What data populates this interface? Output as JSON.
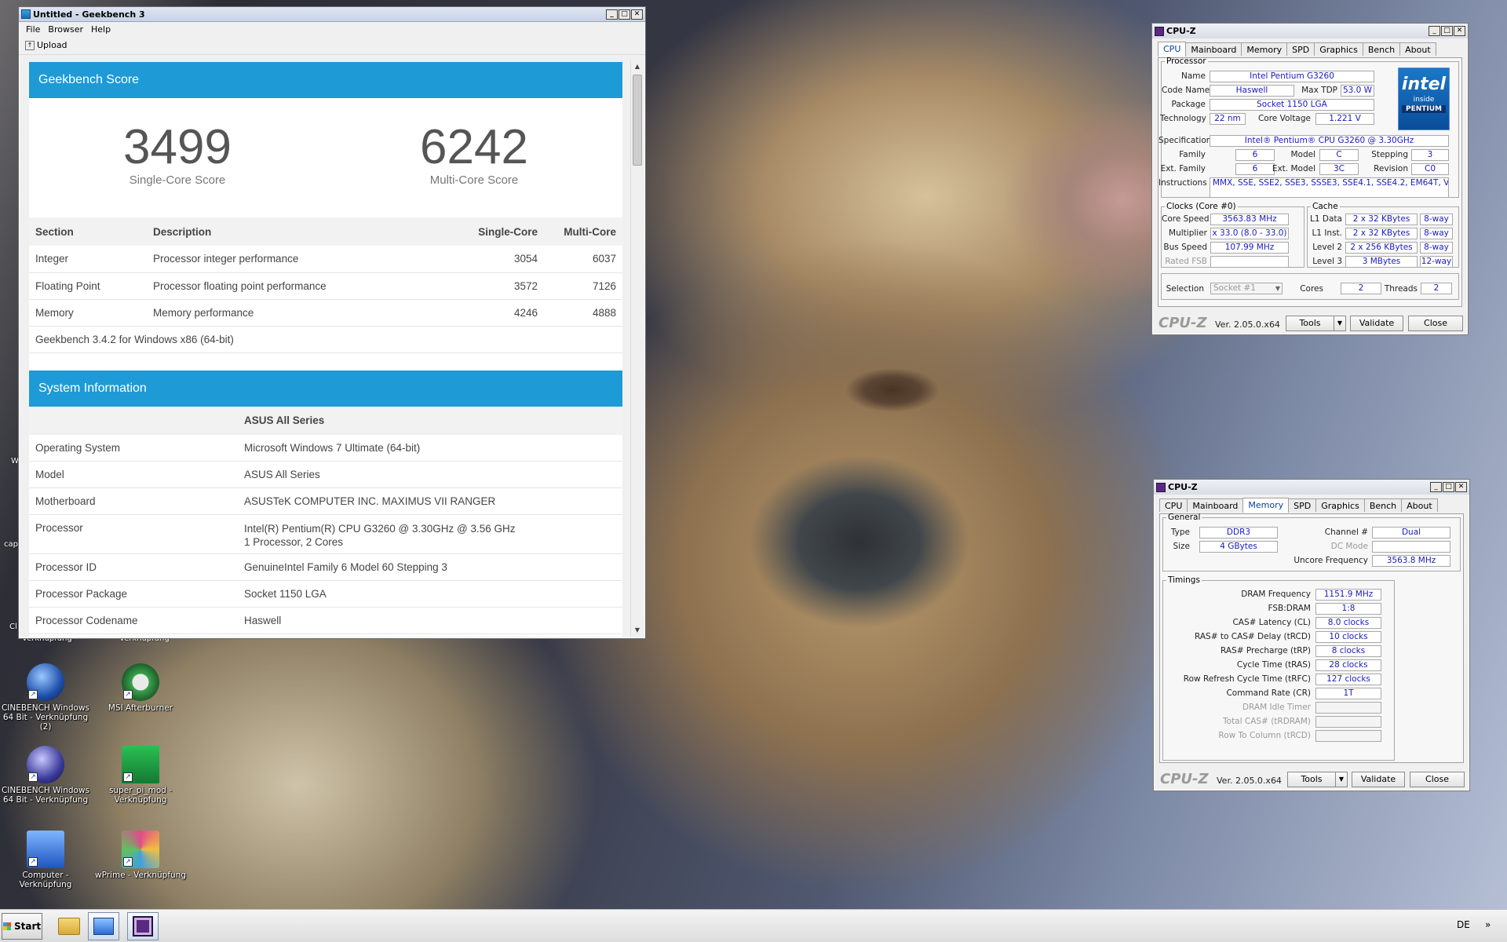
{
  "geekbench": {
    "title": "Untitled - Geekbench 3",
    "menu": [
      "File",
      "Browser",
      "Help"
    ],
    "upload_label": "Upload",
    "score_header": "Geekbench Score",
    "single_score": "3499",
    "single_label": "Single-Core Score",
    "multi_score": "6242",
    "multi_label": "Multi-Core Score",
    "table_headers": [
      "Section",
      "Description",
      "Single-Core",
      "Multi-Core"
    ],
    "rows": [
      [
        "Integer",
        "Processor integer performance",
        "3054",
        "6037"
      ],
      [
        "Floating Point",
        "Processor floating point performance",
        "3572",
        "7126"
      ],
      [
        "Memory",
        "Memory performance",
        "4246",
        "4888"
      ]
    ],
    "version_note": "Geekbench 3.4.2 for Windows x86 (64-bit)",
    "sys_header": "System Information",
    "sys_title": "ASUS All Series",
    "sys_rows": [
      [
        "Operating System",
        "Microsoft Windows 7 Ultimate (64-bit)",
        ""
      ],
      [
        "Model",
        "ASUS All Series",
        ""
      ],
      [
        "Motherboard",
        "ASUSTeK COMPUTER INC. MAXIMUS VII RANGER",
        ""
      ],
      [
        "Processor",
        "Intel(R) Pentium(R) CPU G3260 @ 3.30GHz @ 3.56 GHz",
        "1 Processor, 2 Cores"
      ],
      [
        "Processor ID",
        "GenuineIntel Family 6 Model 60 Stepping 3",
        ""
      ],
      [
        "Processor Package",
        "Socket 1150 LGA",
        ""
      ],
      [
        "Processor Codename",
        "Haswell",
        ""
      ]
    ]
  },
  "cpuz_cpu": {
    "title": "CPU-Z",
    "tabs": [
      "CPU",
      "Mainboard",
      "Memory",
      "SPD",
      "Graphics",
      "Bench",
      "About"
    ],
    "selected_tab": "CPU",
    "processor_legend": "Processor",
    "name_label": "Name",
    "name": "Intel Pentium G3260",
    "codename_label": "Code Name",
    "codename": "Haswell",
    "maxtdp_label": "Max TDP",
    "maxtdp": "53.0 W",
    "package_label": "Package",
    "package": "Socket 1150 LGA",
    "technology_label": "Technology",
    "technology": "22 nm",
    "corevoltage_label": "Core Voltage",
    "corevoltage": "1.221 V",
    "spec_label": "Specification",
    "spec": "Intel® Pentium® CPU G3260 @ 3.30GHz",
    "family_label": "Family",
    "family": "6",
    "model_label": "Model",
    "model": "C",
    "stepping_label": "Stepping",
    "stepping": "3",
    "extfamily_label": "Ext. Family",
    "extfamily": "6",
    "extmodel_label": "Ext. Model",
    "extmodel": "3C",
    "revision_label": "Revision",
    "revision": "C0",
    "instructions_label": "Instructions",
    "instructions": "MMX, SSE, SSE2, SSE3, SSSE3, SSE4.1, SSE4.2, EM64T, VT-x",
    "clocks_legend": "Clocks (Core #0)",
    "corespeed_label": "Core Speed",
    "corespeed": "3563.83 MHz",
    "multiplier_label": "Multiplier",
    "multiplier": "x 33.0 (8.0 - 33.0)",
    "busspeed_label": "Bus Speed",
    "busspeed": "107.99 MHz",
    "ratedfsb_label": "Rated FSB",
    "cache_legend": "Cache",
    "l1d_label": "L1 Data",
    "l1d": "2 x 32 KBytes",
    "l1d_way": "8-way",
    "l1i_label": "L1 Inst.",
    "l1i": "2 x 32 KBytes",
    "l1i_way": "8-way",
    "l2_label": "Level 2",
    "l2": "2 x 256 KBytes",
    "l2_way": "8-way",
    "l3_label": "Level 3",
    "l3": "3 MBytes",
    "l3_way": "12-way",
    "selection_label": "Selection",
    "selection": "Socket #1",
    "cores_label": "Cores",
    "cores": "2",
    "threads_label": "Threads",
    "threads": "2",
    "brand": "CPU-Z",
    "version": "Ver. 2.05.0.x64",
    "tools_label": "Tools",
    "validate_label": "Validate",
    "close_label": "Close",
    "intel_logo": {
      "word": "intel",
      "sub": "inside",
      "tag": "PENTIUM"
    }
  },
  "cpuz_mem": {
    "title": "CPU-Z",
    "tabs": [
      "CPU",
      "Mainboard",
      "Memory",
      "SPD",
      "Graphics",
      "Bench",
      "About"
    ],
    "selected_tab": "Memory",
    "general_legend": "General",
    "type_label": "Type",
    "type": "DDR3",
    "size_label": "Size",
    "size": "4 GBytes",
    "channel_label": "Channel #",
    "channel": "Dual",
    "dcmode_label": "DC Mode",
    "uncore_label": "Uncore Frequency",
    "uncore": "3563.8 MHz",
    "timings_legend": "Timings",
    "timings": [
      {
        "label": "DRAM Frequency",
        "value": "1151.9 MHz",
        "dim": false
      },
      {
        "label": "FSB:DRAM",
        "value": "1:8",
        "dim": false
      },
      {
        "label": "CAS# Latency (CL)",
        "value": "8.0 clocks",
        "dim": false
      },
      {
        "label": "RAS# to CAS# Delay (tRCD)",
        "value": "10 clocks",
        "dim": false
      },
      {
        "label": "RAS# Precharge (tRP)",
        "value": "8 clocks",
        "dim": false
      },
      {
        "label": "Cycle Time (tRAS)",
        "value": "28 clocks",
        "dim": false
      },
      {
        "label": "Row Refresh Cycle Time (tRFC)",
        "value": "127 clocks",
        "dim": false
      },
      {
        "label": "Command Rate (CR)",
        "value": "1T",
        "dim": false
      },
      {
        "label": "DRAM Idle Timer",
        "value": "",
        "dim": true
      },
      {
        "label": "Total CAS# (tRDRAM)",
        "value": "",
        "dim": true
      },
      {
        "label": "Row To Column (tRCD)",
        "value": "",
        "dim": true
      }
    ],
    "brand": "CPU-Z",
    "version": "Ver. 2.05.0.x64",
    "tools_label": "Tools",
    "validate_label": "Validate",
    "close_label": "Close"
  },
  "desktop": {
    "icons": [
      {
        "label": "CINEBENCH Windows 64 Bit - Verknüpfung (2)",
        "icon": "cinebench-icon",
        "color": "#2a5fb8"
      },
      {
        "label": "MSI Afterburner",
        "icon": "msi-afterburner-icon",
        "color": "#3aa34a"
      },
      {
        "label": "CINEBENCH Windows 64 Bit - Verknüpfung",
        "icon": "cinebench-icon",
        "color": "#2a5fb8"
      },
      {
        "label": "super_pi_mod - Verknüpfung",
        "icon": "superpi-icon",
        "color": "#21a84a"
      },
      {
        "label": "Computer - Verknüpfung",
        "icon": "computer-icon",
        "color": "#2a6cd6"
      },
      {
        "label": "wPrime - Verknüpfung",
        "icon": "wprime-icon",
        "color": "#c04080"
      }
    ],
    "partial_labels": [
      "W",
      "cap",
      "Cl",
      "Verknüpfung",
      "Verknüpfung"
    ]
  },
  "taskbar": {
    "start_label": "Start",
    "items": [
      "explorer-icon",
      "control-panel-icon",
      "cpuz-taskbar-icon"
    ],
    "language": "DE",
    "tray_glyph": "»"
  }
}
